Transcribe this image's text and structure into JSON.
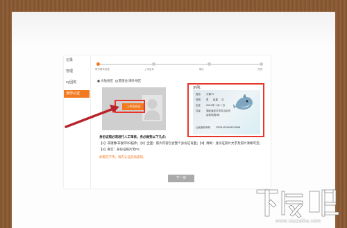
{
  "sidebar": {
    "items": [
      "记录",
      "管理",
      "ey回购"
    ],
    "active_label": "身份认证"
  },
  "steps": [
    "填写基本信息",
    "上传证件",
    "确认",
    "完成"
  ],
  "radio_options": [
    "大陆地区",
    "港澳台/海外地区"
  ],
  "upload": {
    "button_label": "上传身份证"
  },
  "sample": {
    "title": "示例：",
    "name_label": "姓名",
    "name_value": "头像TV",
    "sex_label": "性别",
    "sex_value": "男",
    "nation_label": "民族",
    "nation_value": "汉",
    "birth_label": "出生",
    "birth_value": "2014 年 1 月 1 日",
    "address_label": "住址",
    "address_lines": [
      "湖北省武汉市洪山区光",
      "谷软件园1栋"
    ],
    "id_label": "公民身份号码",
    "id_value": "220314201405012568"
  },
  "instructions": {
    "heading": "身份证照必须进行人工审核，务必做到以下几点：",
    "line1": "【1】非镜像/非复印/扫描件；【2】全面：照片内容包含整个身份证背面；【3】清晰：身份证照片文字及照片清晰可见；",
    "line2": "【4】真实：身份证照片无PS"
  },
  "note": "如需先不传，请先认证后再提现。",
  "next_button": "下一步",
  "watermark": {
    "brand": "下载吧",
    "url": "www.xiazaiba.com"
  },
  "colors": {
    "accent": "#f27b21",
    "highlight": "#e8342b",
    "arrow": "#b8232b"
  }
}
